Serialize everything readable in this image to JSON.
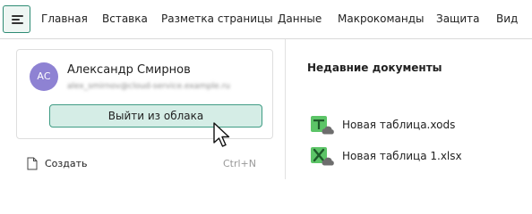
{
  "ribbon": {
    "tabs": [
      "Главная",
      "Вставка",
      "Разметка страницы",
      "Данные",
      "Макрокоманды",
      "Защита",
      "Вид"
    ]
  },
  "account": {
    "initials": "АС",
    "name": "Александр Смирнов",
    "email": "alex_smirnov@cloud-service.example.ru",
    "logout_label": "Выйти из облака"
  },
  "create": {
    "label": "Создать",
    "shortcut": "Ctrl+N"
  },
  "recent": {
    "title": "Недавние документы",
    "documents": [
      {
        "name": "Новая таблица.xods",
        "icon": "xods-spreadsheet-icon"
      },
      {
        "name": "Новая таблица 1.xlsx",
        "icon": "xlsx-spreadsheet-icon"
      }
    ]
  },
  "colors": {
    "accent": "#2e8b74",
    "button_bg": "#d5ede6",
    "avatar_bg": "#8e82d3"
  }
}
